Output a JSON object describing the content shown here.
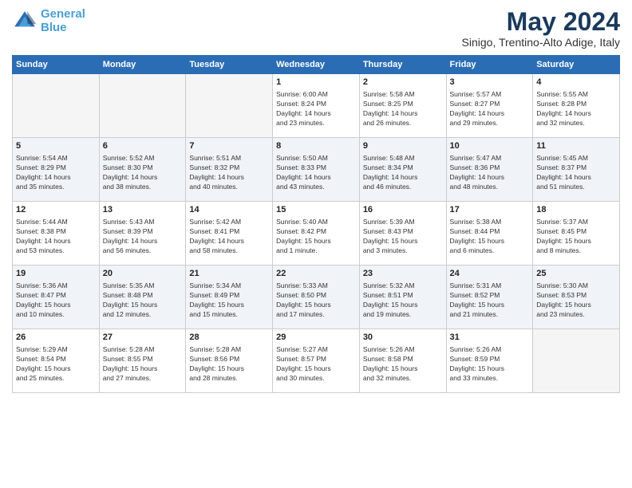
{
  "header": {
    "logo": {
      "line1": "General",
      "line2": "Blue"
    },
    "month_title": "May 2024",
    "subtitle": "Sinigo, Trentino-Alto Adige, Italy"
  },
  "weekdays": [
    "Sunday",
    "Monday",
    "Tuesday",
    "Wednesday",
    "Thursday",
    "Friday",
    "Saturday"
  ],
  "weeks": [
    [
      {
        "day": "",
        "info": ""
      },
      {
        "day": "",
        "info": ""
      },
      {
        "day": "",
        "info": ""
      },
      {
        "day": "1",
        "info": "Sunrise: 6:00 AM\nSunset: 8:24 PM\nDaylight: 14 hours\nand 23 minutes."
      },
      {
        "day": "2",
        "info": "Sunrise: 5:58 AM\nSunset: 8:25 PM\nDaylight: 14 hours\nand 26 minutes."
      },
      {
        "day": "3",
        "info": "Sunrise: 5:57 AM\nSunset: 8:27 PM\nDaylight: 14 hours\nand 29 minutes."
      },
      {
        "day": "4",
        "info": "Sunrise: 5:55 AM\nSunset: 8:28 PM\nDaylight: 14 hours\nand 32 minutes."
      }
    ],
    [
      {
        "day": "5",
        "info": "Sunrise: 5:54 AM\nSunset: 8:29 PM\nDaylight: 14 hours\nand 35 minutes."
      },
      {
        "day": "6",
        "info": "Sunrise: 5:52 AM\nSunset: 8:30 PM\nDaylight: 14 hours\nand 38 minutes."
      },
      {
        "day": "7",
        "info": "Sunrise: 5:51 AM\nSunset: 8:32 PM\nDaylight: 14 hours\nand 40 minutes."
      },
      {
        "day": "8",
        "info": "Sunrise: 5:50 AM\nSunset: 8:33 PM\nDaylight: 14 hours\nand 43 minutes."
      },
      {
        "day": "9",
        "info": "Sunrise: 5:48 AM\nSunset: 8:34 PM\nDaylight: 14 hours\nand 46 minutes."
      },
      {
        "day": "10",
        "info": "Sunrise: 5:47 AM\nSunset: 8:36 PM\nDaylight: 14 hours\nand 48 minutes."
      },
      {
        "day": "11",
        "info": "Sunrise: 5:45 AM\nSunset: 8:37 PM\nDaylight: 14 hours\nand 51 minutes."
      }
    ],
    [
      {
        "day": "12",
        "info": "Sunrise: 5:44 AM\nSunset: 8:38 PM\nDaylight: 14 hours\nand 53 minutes."
      },
      {
        "day": "13",
        "info": "Sunrise: 5:43 AM\nSunset: 8:39 PM\nDaylight: 14 hours\nand 56 minutes."
      },
      {
        "day": "14",
        "info": "Sunrise: 5:42 AM\nSunset: 8:41 PM\nDaylight: 14 hours\nand 58 minutes."
      },
      {
        "day": "15",
        "info": "Sunrise: 5:40 AM\nSunset: 8:42 PM\nDaylight: 15 hours\nand 1 minute."
      },
      {
        "day": "16",
        "info": "Sunrise: 5:39 AM\nSunset: 8:43 PM\nDaylight: 15 hours\nand 3 minutes."
      },
      {
        "day": "17",
        "info": "Sunrise: 5:38 AM\nSunset: 8:44 PM\nDaylight: 15 hours\nand 6 minutes."
      },
      {
        "day": "18",
        "info": "Sunrise: 5:37 AM\nSunset: 8:45 PM\nDaylight: 15 hours\nand 8 minutes."
      }
    ],
    [
      {
        "day": "19",
        "info": "Sunrise: 5:36 AM\nSunset: 8:47 PM\nDaylight: 15 hours\nand 10 minutes."
      },
      {
        "day": "20",
        "info": "Sunrise: 5:35 AM\nSunset: 8:48 PM\nDaylight: 15 hours\nand 12 minutes."
      },
      {
        "day": "21",
        "info": "Sunrise: 5:34 AM\nSunset: 8:49 PM\nDaylight: 15 hours\nand 15 minutes."
      },
      {
        "day": "22",
        "info": "Sunrise: 5:33 AM\nSunset: 8:50 PM\nDaylight: 15 hours\nand 17 minutes."
      },
      {
        "day": "23",
        "info": "Sunrise: 5:32 AM\nSunset: 8:51 PM\nDaylight: 15 hours\nand 19 minutes."
      },
      {
        "day": "24",
        "info": "Sunrise: 5:31 AM\nSunset: 8:52 PM\nDaylight: 15 hours\nand 21 minutes."
      },
      {
        "day": "25",
        "info": "Sunrise: 5:30 AM\nSunset: 8:53 PM\nDaylight: 15 hours\nand 23 minutes."
      }
    ],
    [
      {
        "day": "26",
        "info": "Sunrise: 5:29 AM\nSunset: 8:54 PM\nDaylight: 15 hours\nand 25 minutes."
      },
      {
        "day": "27",
        "info": "Sunrise: 5:28 AM\nSunset: 8:55 PM\nDaylight: 15 hours\nand 27 minutes."
      },
      {
        "day": "28",
        "info": "Sunrise: 5:28 AM\nSunset: 8:56 PM\nDaylight: 15 hours\nand 28 minutes."
      },
      {
        "day": "29",
        "info": "Sunrise: 5:27 AM\nSunset: 8:57 PM\nDaylight: 15 hours\nand 30 minutes."
      },
      {
        "day": "30",
        "info": "Sunrise: 5:26 AM\nSunset: 8:58 PM\nDaylight: 15 hours\nand 32 minutes."
      },
      {
        "day": "31",
        "info": "Sunrise: 5:26 AM\nSunset: 8:59 PM\nDaylight: 15 hours\nand 33 minutes."
      },
      {
        "day": "",
        "info": ""
      }
    ]
  ]
}
